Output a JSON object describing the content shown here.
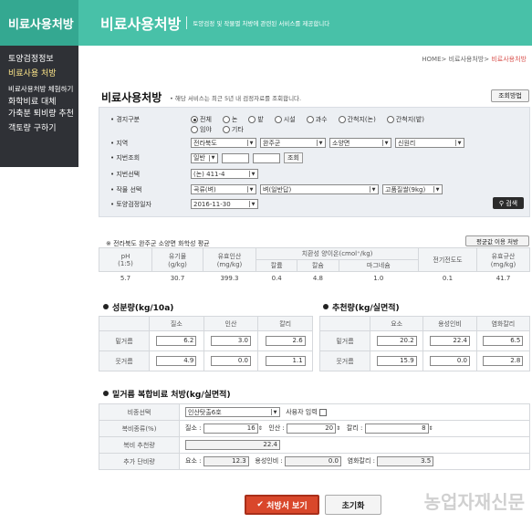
{
  "sidebar": {
    "title": "비료사용처방",
    "items": [
      {
        "label": "토양검정정보"
      },
      {
        "label": "비료사용 처방"
      },
      {
        "label": "비료사용처방 체험하기"
      },
      {
        "label": "화학비료 대체"
      },
      {
        "label": "가축분 퇴비량 추천"
      },
      {
        "label": "객토량 구하기"
      }
    ]
  },
  "banner": {
    "title": "비료사용처방",
    "desc": "토양검정 및 작물별 처방에 관련된 서비스를 제공합니다"
  },
  "breadcrumb": {
    "home": "HOME>",
    "mid": "비료사용처방>",
    "current": "비료사용처방"
  },
  "main": {
    "title": "비료사용처방",
    "note": "• 해당 서비스는 최근 5년 내 검정자료를 조회합니다.",
    "lookup_button": "조회방법"
  },
  "form": {
    "land_label": "경지구분",
    "land_options": [
      "전체",
      "논",
      "밭",
      "시설",
      "과수",
      "간척지(논)",
      "간척지(밭)",
      "임야",
      "기타"
    ],
    "region_label": "지역",
    "region_values": [
      "전라북도",
      "완주군",
      "소양면",
      "신원리"
    ],
    "lot_label": "지번조회",
    "lot_type": "일반",
    "lot_button": "조회",
    "lot_select_label": "지번선택",
    "lot_select_value": "(논) 411-4",
    "crop_label": "작물 선택",
    "crop_values": [
      "곡류(벼)",
      "벼(일반답)",
      "고품질쌀(9kg)"
    ],
    "date_label": "토양검정일자",
    "date_value": "2016-11-30",
    "search_button": "검색"
  },
  "chem": {
    "title": "※ 전라북도 완주군 소양면 화학성 평균",
    "avg_button": "평균값 이용 처방",
    "headers": {
      "ph": "pH",
      "ph_unit": "(1:5)",
      "om": "유기물",
      "om_unit": "(g/kg)",
      "p": "유효인산",
      "p_unit": "(mg/kg)",
      "cation": "치환성 양이온(cmol⁺/kg)",
      "k": "칼륨",
      "ca": "칼슘",
      "mg": "마그네슘",
      "ec": "전기전도도",
      "si": "유효규산",
      "si_unit": "(mg/kg)"
    },
    "values": [
      "5.7",
      "30.7",
      "399.3",
      "0.4",
      "4.8",
      "1.0",
      "0.1",
      "41.7"
    ]
  },
  "ingredient": {
    "title": "성분량(kg/10a)",
    "cols": [
      "질소",
      "인산",
      "칼리"
    ],
    "rows": [
      {
        "label": "밑거름",
        "values": [
          "6.2",
          "3.0",
          "2.6"
        ]
      },
      {
        "label": "웃거름",
        "values": [
          "4.9",
          "0.0",
          "1.1"
        ]
      }
    ]
  },
  "recommend": {
    "title": "추천량(kg/실면적)",
    "cols": [
      "요소",
      "용성인비",
      "염화칼리"
    ],
    "rows": [
      {
        "label": "밑거름",
        "values": [
          "20.2",
          "22.4",
          "6.5"
        ]
      },
      {
        "label": "웃거름",
        "values": [
          "15.9",
          "0.0",
          "2.8"
        ]
      }
    ]
  },
  "compound": {
    "title": "밑거름 복합비료 처방(kg/실면적)",
    "type_label": "비종선택",
    "type_value": "인산탓출6호",
    "user_input_label": "사용자 입력",
    "ratio_label": "복비종류(%)",
    "ratio_n_label": "질소 :",
    "ratio_n": "16",
    "ratio_p_label": "인산 :",
    "ratio_p": "20",
    "ratio_k_label": "칼리 :",
    "ratio_k": "8",
    "amount_label": "복비 추천량",
    "amount": "22.4",
    "extra_label": "추가 단비량",
    "extra_urea_label": "요소 :",
    "extra_urea": "12.3",
    "extra_p_label": "용성인비 :",
    "extra_p": "0.0",
    "extra_k_label": "염화칼리 :",
    "extra_k": "3.5"
  },
  "actions": {
    "view": "처방서 보기",
    "reset": "초기화"
  },
  "watermark": "농업자재신문"
}
